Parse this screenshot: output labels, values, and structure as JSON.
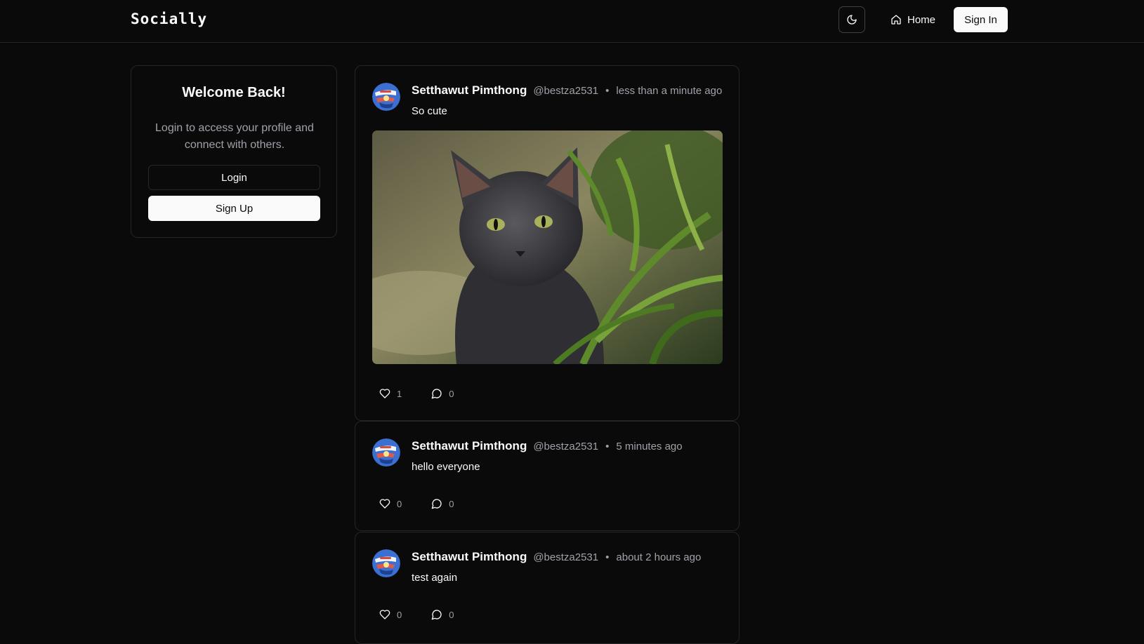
{
  "app": {
    "logo": "Socially"
  },
  "header": {
    "theme_icon": "moon-icon",
    "home_label": "Home",
    "home_icon": "home-icon",
    "signin_label": "Sign In"
  },
  "welcome": {
    "title": "Welcome Back!",
    "subtitle": "Login to access your profile and connect with others.",
    "login_label": "Login",
    "signup_label": "Sign Up"
  },
  "posts": [
    {
      "author": "Setthawut Pimthong",
      "handle": "@bestza2531",
      "separator": "•",
      "time": "less than a minute ago",
      "text": "So cute",
      "likes": "1",
      "comments": "0",
      "has_image": true
    },
    {
      "author": "Setthawut Pimthong",
      "handle": "@bestza2531",
      "separator": "•",
      "time": "5 minutes ago",
      "text": "hello everyone",
      "likes": "0",
      "comments": "0",
      "has_image": false
    },
    {
      "author": "Setthawut Pimthong",
      "handle": "@bestza2531",
      "separator": "•",
      "time": "about 2 hours ago",
      "text": "test again",
      "likes": "0",
      "comments": "0",
      "has_image": false
    }
  ],
  "colors": {
    "background": "#0a0a0a",
    "border": "#262626",
    "foreground": "#fafafa",
    "muted": "#a1a1aa"
  }
}
